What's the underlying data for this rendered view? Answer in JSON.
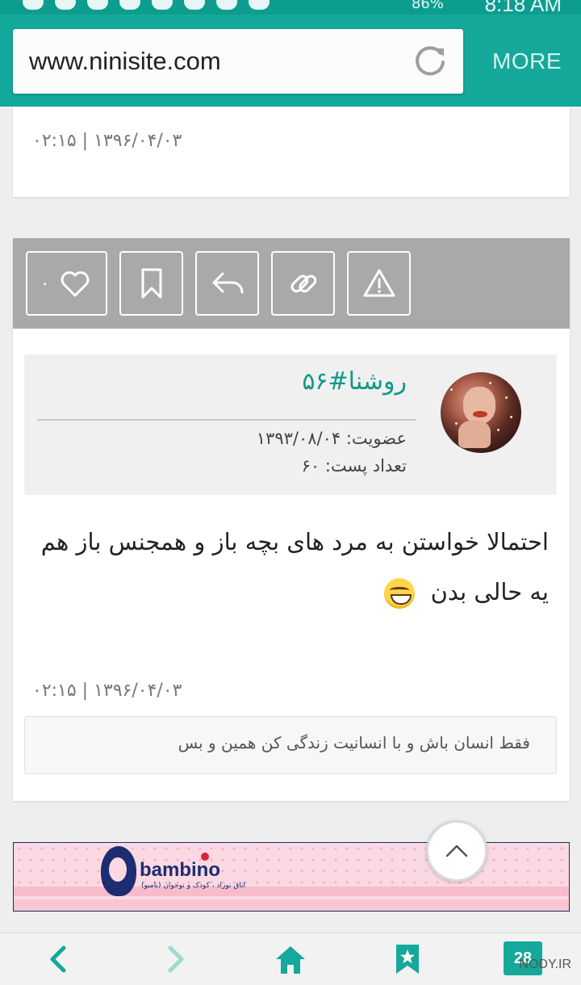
{
  "browser": {
    "url": "www.ninisite.com",
    "more_label": "MORE",
    "status_time": "8:18 AM",
    "status_battery": "86%"
  },
  "posts": [
    {
      "timestamp": "۰۲:۱۵ | ۱۳۹۶/۰۴/۰۳"
    },
    {
      "actions": {
        "like_count": "۰",
        "like_icon": "heart-icon",
        "bookmark_icon": "bookmark-icon",
        "reply_icon": "reply-icon",
        "link_icon": "link-icon",
        "report_icon": "warning-icon"
      },
      "author": {
        "name": "روشنا#۵۶",
        "join_label": "عضویت:",
        "join_date": "۱۳۹۳/۰۸/۰۴",
        "posts_label": "تعداد پست:",
        "posts_count": "۶۰"
      },
      "body": "احتمالا خواستن به مرد های بچه باز و همجنس باز هم یه حالی بدن",
      "timestamp": "۰۲:۱۵ | ۱۳۹۶/۰۴/۰۳",
      "signature": "فقط انسان باش و با انسانیت زندگی کن همین و بس"
    }
  ],
  "ad": {
    "brand": "bambino",
    "tagline": "اتاق نوزاد ، کودک و نوجوان (بامبو)"
  },
  "bottom_nav": {
    "tabs_count": "28",
    "watermark": "NODY.IR"
  },
  "colors": {
    "primary": "#14a99a",
    "username": "#11988a",
    "actions_bar": "#a9a9a9"
  }
}
